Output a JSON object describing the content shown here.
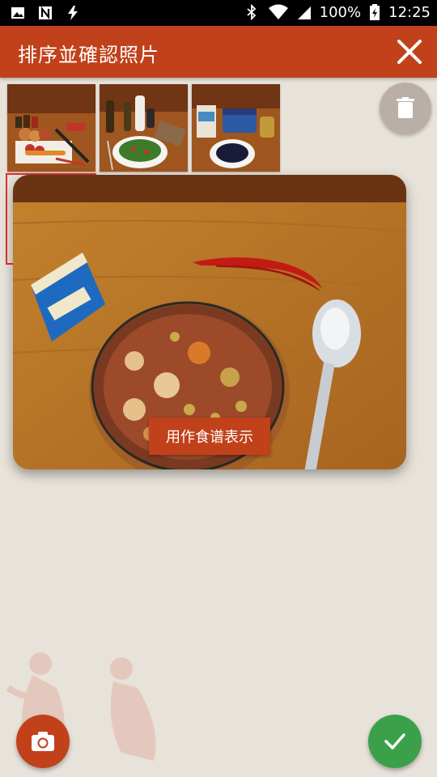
{
  "status_bar": {
    "battery_percent": "100%",
    "time": "12:25",
    "icons": [
      "image-icon",
      "n-notification-icon",
      "flash-icon",
      "bluetooth-icon",
      "wifi-icon",
      "battery-charging-icon"
    ]
  },
  "app_bar": {
    "title": "排序並確認照片",
    "close_icon": "close-icon"
  },
  "thumbnails": [
    {
      "name": "ingredients-vegetables"
    },
    {
      "name": "salad-and-oils"
    },
    {
      "name": "blueberries-and-jars"
    }
  ],
  "preview": {
    "action_label": "用作食谱表示"
  },
  "fabs": {
    "delete_icon": "trash-icon",
    "camera_icon": "camera-icon",
    "confirm_icon": "check-icon"
  },
  "colors": {
    "primary": "#c1411b",
    "confirm": "#3aa14a",
    "background": "#e7e2da",
    "delete_fab": "#b9afa7"
  }
}
